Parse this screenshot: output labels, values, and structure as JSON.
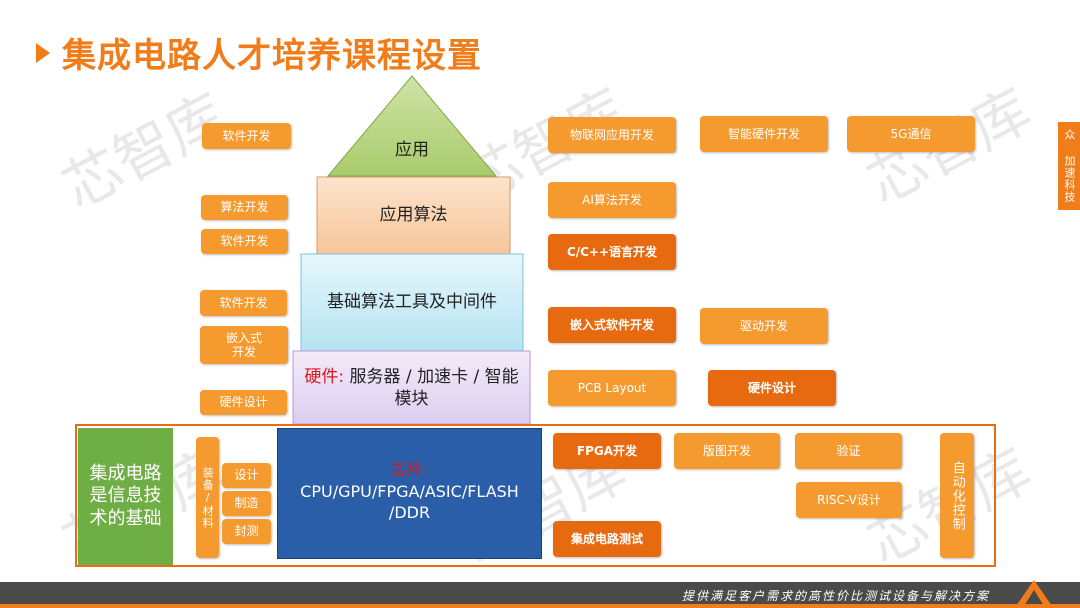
{
  "header": {
    "title": "集成电路人才培养课程设置"
  },
  "watermark": "芯智库",
  "side_tab": "众 加速科技",
  "pyramid": {
    "apex": "应用",
    "level2": "应用算法",
    "level3": "基础算法工具及中间件",
    "level4_prefix": "硬件:",
    "level4_text": "服务器 / 加速卡 / 智能模块",
    "chip_prefix": "芯片:",
    "chip_text": "CPU/GPU/FPGA/ASIC/FLASH /DDR"
  },
  "left": {
    "b1": "软件开发",
    "b2": "算法开发",
    "b3": "软件开发",
    "b4": "软件开发",
    "b5": "嵌入式\n开发",
    "b6": "硬件设计"
  },
  "right": {
    "iot": "物联网应用开发",
    "smart_hw": "智能硬件开发",
    "fiveg": "5G通信",
    "ai": "AI算法开发",
    "cpp": "C/C++语言开发",
    "embedded_sw": "嵌入式软件开发",
    "driver": "驱动开发",
    "pcb": "PCB Layout",
    "hw_design": "硬件设计"
  },
  "foundation": {
    "label": "集成电路\n是信息技\n术的基础",
    "equip": "装备/材料",
    "design": "设计",
    "manufacture": "制造",
    "package_test": "封测",
    "fpga": "FPGA开发",
    "layout": "版图开发",
    "verify": "验证",
    "riscv": "RISC-V设计",
    "ic_test": "集成电路测试",
    "automation": "自动化控制"
  },
  "footer": {
    "slogan": "提供满足客户需求的高性价比测试设备与解决方案"
  },
  "colors": {
    "accent": "#f07d1a",
    "dark_orange": "#e86a10",
    "green": "#6fae45",
    "chip_blue": "#2a5ea8"
  }
}
